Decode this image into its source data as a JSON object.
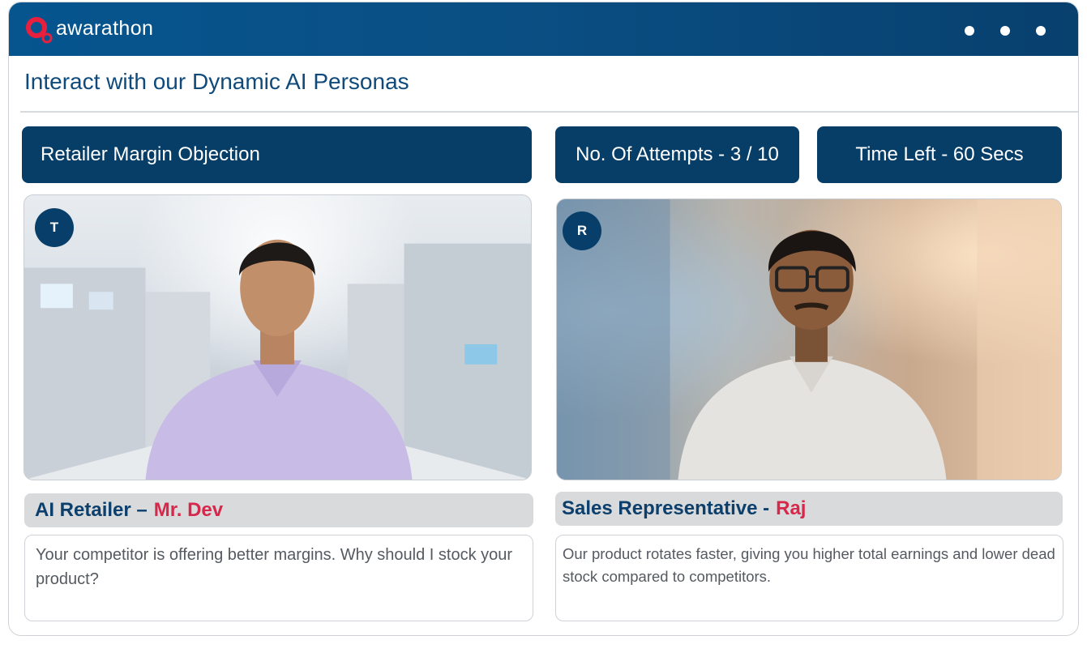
{
  "app": {
    "logo_text": "awarathon",
    "brand_color": "#06558f",
    "accent_color": "#e8203e"
  },
  "page": {
    "title": "Interact with our Dynamic AI Personas"
  },
  "status_bar": {
    "scenario": "Retailer Margin Objection",
    "attempts": "No. Of Attempts - 3 / 10",
    "time_left": "Time Left - 60 Secs"
  },
  "participants": {
    "left": {
      "avatar_initial": "T",
      "role": "AI Retailer –",
      "name": "Mr. Dev",
      "message": "Your competitor is offering better margins. Why should I stock your product?"
    },
    "right": {
      "avatar_initial": "R",
      "role": "Sales Representative -",
      "name": "Raj",
      "message": "Our product rotates faster, giving you higher total earnings and lower dead stock compared to competitors."
    }
  },
  "icons": {
    "logo": "awarathon-logo-icon",
    "menu": "more-dots-icon"
  }
}
